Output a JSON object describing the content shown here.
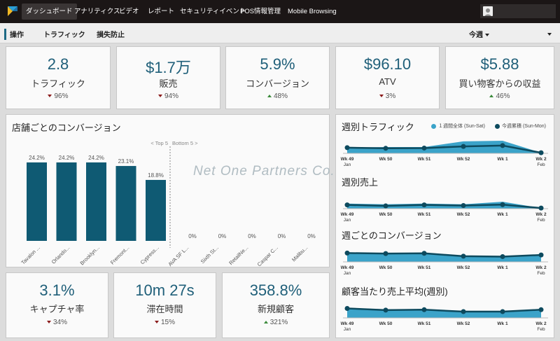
{
  "nav": {
    "items": [
      "ダッシュボード",
      "アナリティクス",
      "ビデオ",
      "レポート",
      "セキュリティイベント",
      "POS情報管理",
      "Mobile Browsing"
    ]
  },
  "subbar": {
    "tabs": [
      "操作",
      "トラフィック",
      "損失防止"
    ],
    "period": "今週"
  },
  "kpis_top": [
    {
      "value": "2.8",
      "label": "トラフィック",
      "delta": "96%",
      "dir": "down"
    },
    {
      "value": "$1.7万",
      "label": "販売",
      "delta": "94%",
      "dir": "down"
    },
    {
      "value": "5.9%",
      "label": "コンバージョン",
      "delta": "48%",
      "dir": "up"
    },
    {
      "value": "$96.10",
      "label": "ATV",
      "delta": "3%",
      "dir": "down"
    },
    {
      "value": "$5.88",
      "label": "買い物客からの収益",
      "delta": "46%",
      "dir": "up"
    }
  ],
  "kpis_bottom": [
    {
      "value": "3.1%",
      "label": "キャプチャ率",
      "delta": "34%",
      "dir": "down"
    },
    {
      "value": "10m 27s",
      "label": "滞在時間",
      "delta": "15%",
      "dir": "down"
    },
    {
      "value": "358.8%",
      "label": "新規顧客",
      "delta": "321%",
      "dir": "up"
    }
  ],
  "store_conversion": {
    "title": "店舗ごとのコンバージョン",
    "top_label": "< Top 5",
    "bottom_label": "Bottom 5 >",
    "watermark": "Net One Partners Co., Ltd."
  },
  "weekly": {
    "legend_all": "１週間全体 (Sun-Sat)",
    "legend_this": "今週累積 (Sun-Mon)",
    "x_labels": [
      [
        "Wk 49",
        "Jan"
      ],
      [
        "Wk 50",
        ""
      ],
      [
        "Wk 51",
        ""
      ],
      [
        "Wk 52",
        ""
      ],
      [
        "Wk 1",
        ""
      ],
      [
        "Wk 2",
        "Feb"
      ]
    ],
    "titles": [
      "週別トラフィック",
      "週別売上",
      "週ごとのコンバージョン",
      "顧客当たり売上平均(週別)"
    ]
  },
  "colors": {
    "accent": "#1f5f79",
    "bar": "#0f5a73",
    "area": "#3ba3c9",
    "line": "#0d4a5e",
    "down": "#8b1c1c",
    "up": "#3a8a3a"
  },
  "chart_data": [
    {
      "type": "bar",
      "title": "店舗ごとのコンバージョン",
      "categories": [
        "Tavalon ...",
        "Orlando...",
        "Brooklyn...",
        "Fremont...",
        "Cypress...",
        "AVA SF L...",
        "Sixth St...",
        "RetailNe...",
        "Caspar C...",
        "Malibu..."
      ],
      "values": [
        24.2,
        24.2,
        24.2,
        23.1,
        18.8,
        0,
        0,
        0,
        0,
        0
      ],
      "value_labels": [
        "24.2%",
        "24.2%",
        "24.2%",
        "23.1%",
        "18.8%",
        "0%",
        "0%",
        "0%",
        "0%",
        "0%"
      ],
      "ylim": [
        0,
        27
      ]
    },
    {
      "type": "area",
      "title": "週別トラフィック",
      "x": [
        "Wk 49",
        "Wk 50",
        "Wk 51",
        "Wk 52",
        "Wk 1",
        "Wk 2"
      ],
      "series": [
        {
          "name": "１週間全体 (Sun-Sat)",
          "values": [
            0.45,
            0.5,
            0.5,
            0.95,
            1.0,
            0.05
          ]
        },
        {
          "name": "今週累積 (Sun-Mon)",
          "values": [
            0.45,
            0.4,
            0.42,
            0.55,
            0.62,
            0.05
          ]
        }
      ]
    },
    {
      "type": "area",
      "title": "週別売上",
      "x": [
        "Wk 49",
        "Wk 50",
        "Wk 51",
        "Wk 52",
        "Wk 1",
        "Wk 2"
      ],
      "series": [
        {
          "name": "１週間全体 (Sun-Sat)",
          "values": [
            0.4,
            0.35,
            0.4,
            0.35,
            0.55,
            0.05
          ]
        },
        {
          "name": "今週累積 (Sun-Mon)",
          "values": [
            0.3,
            0.22,
            0.3,
            0.25,
            0.32,
            0.05
          ]
        }
      ]
    },
    {
      "type": "area",
      "title": "週ごとのコンバージョン",
      "x": [
        "Wk 49",
        "Wk 50",
        "Wk 51",
        "Wk 52",
        "Wk 1",
        "Wk 2"
      ],
      "series": [
        {
          "name": "１週間全体 (Sun-Sat)",
          "values": [
            0.75,
            0.7,
            0.72,
            0.5,
            0.45,
            0.6
          ]
        },
        {
          "name": "今週累積 (Sun-Mon)",
          "values": [
            0.7,
            0.66,
            0.68,
            0.45,
            0.42,
            0.55
          ]
        }
      ]
    },
    {
      "type": "area",
      "title": "顧客当たり売上平均(週別)",
      "x": [
        "Wk 49",
        "Wk 50",
        "Wk 51",
        "Wk 52",
        "Wk 1",
        "Wk 2"
      ],
      "series": [
        {
          "name": "１週間全体 (Sun-Sat)",
          "values": [
            0.8,
            0.68,
            0.7,
            0.55,
            0.55,
            0.7
          ]
        },
        {
          "name": "今週累積 (Sun-Mon)",
          "values": [
            0.75,
            0.62,
            0.65,
            0.5,
            0.5,
            0.65
          ]
        }
      ]
    }
  ]
}
